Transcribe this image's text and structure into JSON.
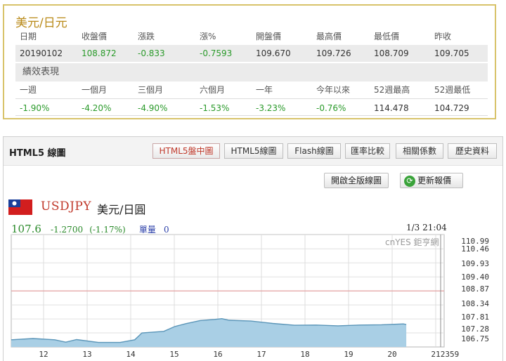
{
  "quote": {
    "title": "美元/日元",
    "headers": [
      "日期",
      "收盤價",
      "漲跌",
      "漲%",
      "開盤價",
      "最高價",
      "最低價",
      "昨收"
    ],
    "values": [
      "20190102",
      "108.872",
      "-0.833",
      "-0.7593",
      "109.670",
      "109.726",
      "108.709",
      "109.705"
    ],
    "section_title": "績效表現",
    "perf_headers": [
      "一週",
      "一個月",
      "三個月",
      "六個月",
      "一年",
      "今年以來",
      "52週最高",
      "52週最低"
    ],
    "perf_values": [
      "-1.90%",
      "-4.20%",
      "-4.90%",
      "-1.53%",
      "-3.23%",
      "-0.76%",
      "114.478",
      "104.729"
    ]
  },
  "panel": {
    "title": "HTML5 線圖",
    "tabs": [
      {
        "label": "HTML5盤中圖",
        "active": true
      },
      {
        "label": "HTML5線圖",
        "active": false
      },
      {
        "label": "Flash線圖",
        "active": false
      },
      {
        "label": "匯率比較",
        "active": false
      },
      {
        "label": "相關係數",
        "active": false
      },
      {
        "label": "歷史資料",
        "active": false
      }
    ],
    "fullscreen_button": "開啟全版線圖",
    "refresh_button": "更新報價"
  },
  "instrument": {
    "symbol": "USDJPY",
    "name": "美元/日圓",
    "last": "107.6",
    "change": "-1.2700",
    "change_pct": "(-1.17%)",
    "volume_label": "單量",
    "volume": "0",
    "time": "1/3 21:04",
    "watermark": "cnYES 鉅亨網"
  },
  "colors": {
    "up_down_green": "#2a9a2a",
    "accent_red": "#c0392b",
    "line": "#5a95b8",
    "fill": "#a9cfe5",
    "ref_line": "#e59a9a",
    "border_gold": "#d8c36a"
  },
  "chart_data": {
    "type": "area",
    "x_ticks": [
      "12",
      "13",
      "14",
      "15",
      "16",
      "17",
      "18",
      "19",
      "20",
      "21",
      "2359"
    ],
    "y_ticks": [
      "110.99",
      "110.46",
      "109.93",
      "109.40",
      "108.87",
      "108.34",
      "107.81",
      "107.28",
      "106.75"
    ],
    "ylim": [
      106.75,
      111.0
    ],
    "reference_value": 108.87,
    "series": [
      {
        "x": [
          "12:00",
          "12:30",
          "13:00",
          "13:15",
          "13:30",
          "14:00",
          "14:30",
          "14:50",
          "15:00",
          "15:30",
          "15:45",
          "16:00",
          "16:20",
          "16:40",
          "16:50",
          "17:00",
          "17:30",
          "18:00",
          "18:30",
          "19:00",
          "19:30",
          "20:00",
          "20:30",
          "21:00",
          "21:04"
        ],
        "values": [
          107.02,
          107.07,
          107.02,
          106.93,
          107.03,
          106.92,
          106.92,
          107.02,
          107.28,
          107.34,
          107.52,
          107.63,
          107.75,
          107.79,
          107.82,
          107.76,
          107.73,
          107.64,
          107.57,
          107.58,
          107.55,
          107.58,
          107.59,
          107.62,
          107.6
        ]
      }
    ]
  }
}
